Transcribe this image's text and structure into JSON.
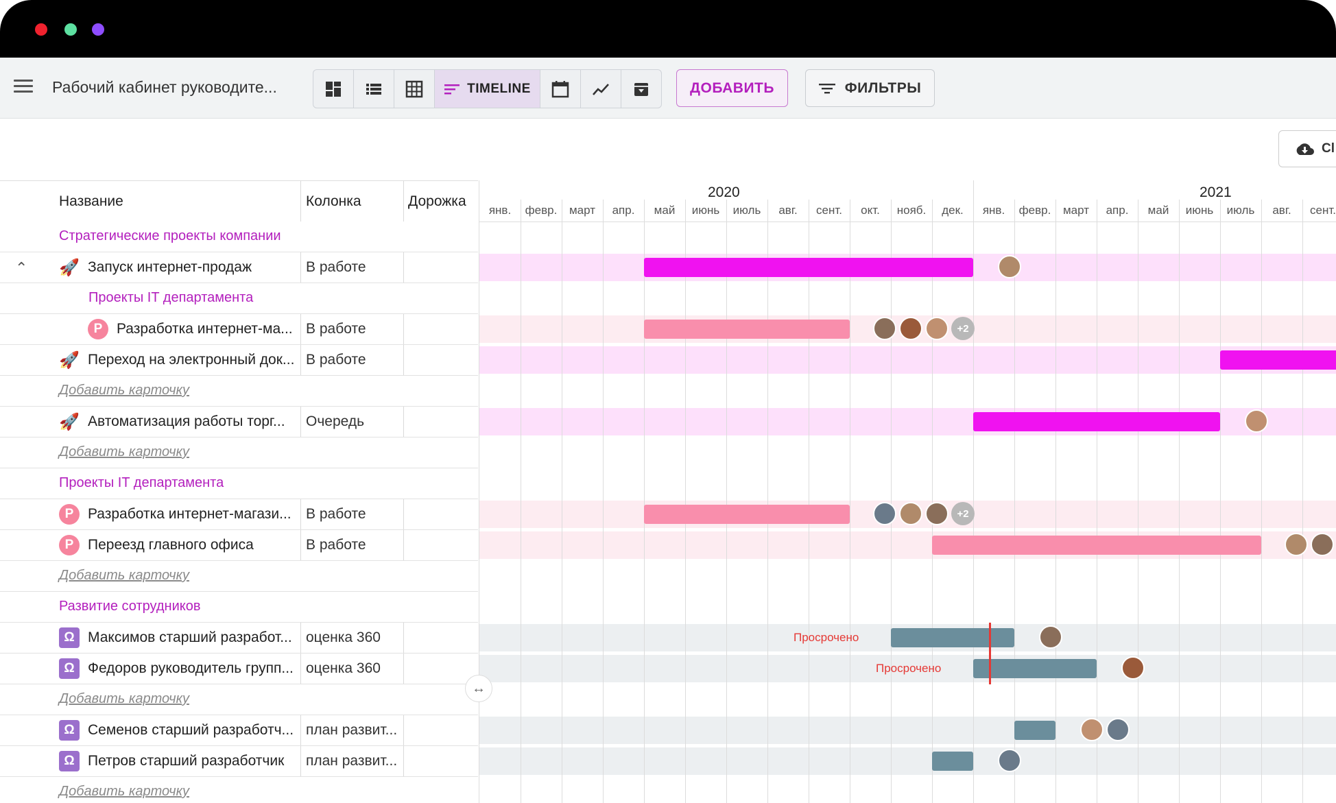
{
  "window": {
    "dots": [
      "#f0222e",
      "#5de0a1",
      "#8e4dff"
    ]
  },
  "toolbar": {
    "board_title": "Рабочий кабинет руководите...",
    "view_active_label": "TIMELINE",
    "add_label": "ДОБАВИТЬ",
    "filter_label": "ФИЛЬТРЫ",
    "export_label": "Cl",
    "accent": "#b31fbd"
  },
  "table": {
    "headers": {
      "name": "Название",
      "column": "Колонка",
      "lane": "Дорожка"
    },
    "add_card": "Добавить карточку",
    "rows": [
      {
        "type": "group",
        "name": "Стратегические проекты компании"
      },
      {
        "type": "item",
        "name": "Запуск интернет-продаж",
        "column": "В работе",
        "icon": "rocket-icon",
        "collapse": true
      },
      {
        "type": "subgroup",
        "name": "Проекты IT департамента"
      },
      {
        "type": "item",
        "name": "Разработка интернет-ма...",
        "column": "В работе",
        "icon": "P",
        "indent": true
      },
      {
        "type": "item",
        "name": "Переход на электронный док...",
        "column": "В работе",
        "icon": "rocket-icon"
      },
      {
        "type": "add"
      },
      {
        "type": "item",
        "name": "Автоматизация работы торг...",
        "column": "Очередь",
        "icon": "rocket-icon"
      },
      {
        "type": "add"
      },
      {
        "type": "group",
        "name": "Проекты IT департамента"
      },
      {
        "type": "item",
        "name": "Разработка интернет-магази...",
        "column": "В работе",
        "icon": "P"
      },
      {
        "type": "item",
        "name": "Переезд главного офиса",
        "column": "В работе",
        "icon": "P"
      },
      {
        "type": "add"
      },
      {
        "type": "group",
        "name": "Развитие сотрудников"
      },
      {
        "type": "item",
        "name": "Максимов старший разработ...",
        "column": "оценка 360",
        "icon": "Ω"
      },
      {
        "type": "item",
        "name": "Федоров руководитель групп...",
        "column": "оценка 360",
        "icon": "Ω"
      },
      {
        "type": "add"
      },
      {
        "type": "item",
        "name": "Семенов старший разработч...",
        "column": "план развит...",
        "icon": "Ω"
      },
      {
        "type": "item",
        "name": "Петров старший разработчик",
        "column": "план развит...",
        "icon": "Ω"
      },
      {
        "type": "add"
      }
    ]
  },
  "timeline": {
    "years": [
      "2020",
      "2021"
    ],
    "months": [
      "янв.",
      "февр.",
      "март",
      "апр.",
      "май",
      "июнь",
      "июль",
      "авг.",
      "сент.",
      "окт.",
      "нояб.",
      "дек.",
      "янв.",
      "февр.",
      "март",
      "апр.",
      "май",
      "июнь",
      "июль",
      "авг.",
      "сент."
    ],
    "overdue_label": "Просрочено",
    "more_count": "+2",
    "colors": {
      "project": "#f012f0",
      "project_band": "#fde0fb",
      "p_bar": "#f98eac",
      "p_band": "#fdecf1",
      "person_bar": "#6b8e9c",
      "person_band": "#eceff1",
      "today": "#e53935"
    },
    "bars": [
      {
        "row": 1,
        "kind": "project",
        "start": "2020-05",
        "end": "2020-12",
        "label": "Запуск интернет-продаж"
      },
      {
        "row": 3,
        "kind": "p",
        "start": "2020-05",
        "end": "2020-09"
      },
      {
        "row": 4,
        "kind": "project",
        "start": "2021-07",
        "end": "2021-09"
      },
      {
        "row": 6,
        "kind": "project",
        "start": "2021-01",
        "end": "2021-06"
      },
      {
        "row": 9,
        "kind": "p",
        "start": "2020-05",
        "end": "2020-09"
      },
      {
        "row": 10,
        "kind": "p",
        "start": "2020-12",
        "end": "2021-07"
      },
      {
        "row": 13,
        "kind": "person",
        "start": "2020-11",
        "end": "2021-01",
        "overdue": true
      },
      {
        "row": 14,
        "kind": "person",
        "start": "2021-01",
        "end": "2021-03",
        "overdue": true
      },
      {
        "row": 16,
        "kind": "person",
        "start": "2021-02",
        "end": "2021-02"
      },
      {
        "row": 17,
        "kind": "person",
        "start": "2020-12",
        "end": "2020-12"
      }
    ]
  }
}
